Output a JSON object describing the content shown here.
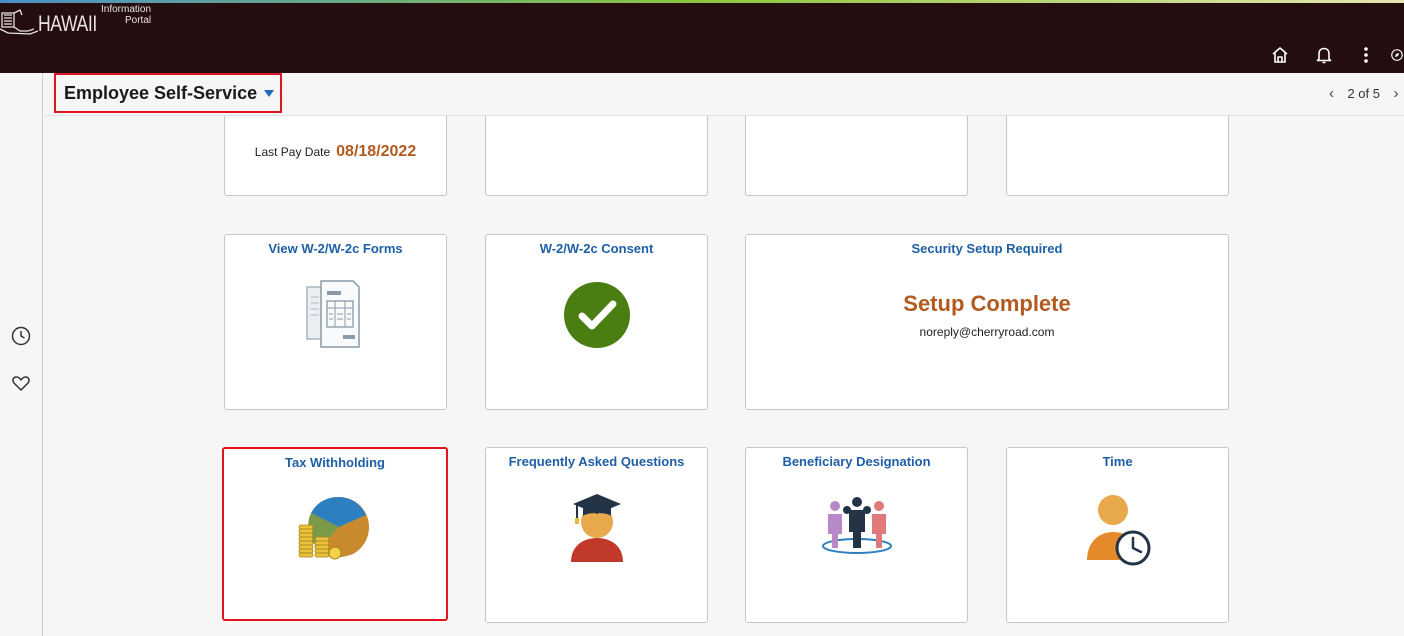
{
  "header": {
    "logo_word": "HAWAII",
    "logo_sub_line1": "Information",
    "logo_sub_line2": "Portal",
    "icons": [
      "home-icon",
      "bell-icon",
      "more-vertical-icon",
      "compass-icon"
    ]
  },
  "leftrail": {
    "icons": [
      "clock-icon",
      "heart-icon"
    ]
  },
  "titlebar": {
    "title": "Employee Self-Service",
    "pager_text": "2 of 5"
  },
  "tiles": {
    "paycheck": {
      "last_pay_label": "Last Pay Date",
      "last_pay_value": "08/18/2022"
    },
    "w2_forms": {
      "title": "View W-2/W-2c Forms"
    },
    "w2_consent": {
      "title": "W-2/W-2c Consent"
    },
    "security": {
      "title": "Security Setup Required",
      "status": "Setup Complete",
      "email": "noreply@cherryroad.com"
    },
    "tax": {
      "title": "Tax Withholding"
    },
    "faq": {
      "title": "Frequently Asked Questions"
    },
    "beneficiary": {
      "title": "Beneficiary Designation"
    },
    "time": {
      "title": "Time"
    }
  },
  "colors": {
    "header_bg": "#240d0f",
    "link_blue": "#1e5fa6",
    "accent_orange": "#b35a1f",
    "highlight_red": "#e0161d",
    "check_green": "#4a7d12"
  }
}
